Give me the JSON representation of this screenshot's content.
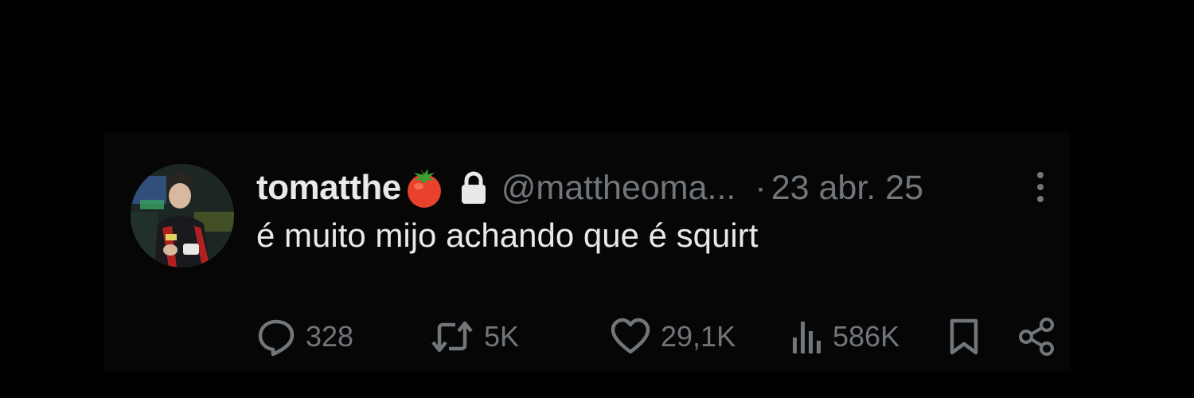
{
  "tweet": {
    "display_name": "tomatthe",
    "name_emoji": "tomato-emoji",
    "locked_icon": "lock-icon",
    "handle": "@mattheoma...",
    "separator": "·",
    "date": "23 abr. 25",
    "text": "é muito mijo achando que é squirt"
  },
  "actions": {
    "reply": {
      "icon": "reply-icon",
      "count": "328"
    },
    "repost": {
      "icon": "repost-icon",
      "count": "5K"
    },
    "like": {
      "icon": "heart-icon",
      "count": "29,1K"
    },
    "views": {
      "icon": "views-icon",
      "count": "586K"
    },
    "bookmark": {
      "icon": "bookmark-icon"
    },
    "share": {
      "icon": "share-icon"
    }
  },
  "colors": {
    "background": "#000000",
    "card": "#060606",
    "primary_text": "#e7e9ea",
    "secondary_text": "#71767b",
    "tomato": "#e8412c"
  }
}
